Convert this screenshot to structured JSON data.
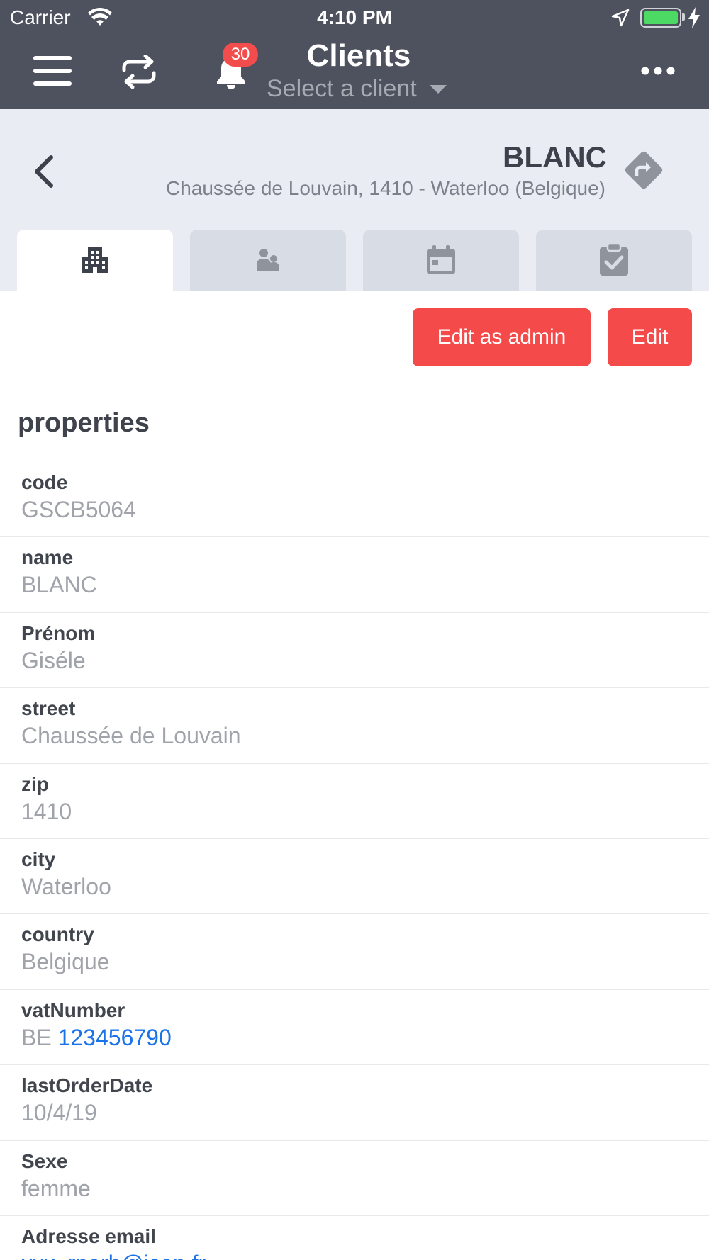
{
  "status_bar": {
    "carrier": "Carrier",
    "time": "4:10 PM"
  },
  "nav": {
    "title": "Clients",
    "subtitle": "Select a client",
    "notification_count": "30",
    "icons": [
      "menu-icon",
      "sync-icon",
      "bell-icon",
      "more-icon"
    ]
  },
  "client": {
    "name": "BLANC",
    "address": "Chaussée de Louvain, 1410 - Waterloo (Belgique)"
  },
  "tabs": [
    {
      "icon": "building-icon",
      "active": true
    },
    {
      "icon": "contacts-icon",
      "active": false
    },
    {
      "icon": "calendar-icon",
      "active": false
    },
    {
      "icon": "clipboard-check-icon",
      "active": false
    }
  ],
  "actions": {
    "edit_admin_label": "Edit as admin",
    "edit_label": "Edit"
  },
  "section_title": "properties",
  "properties": [
    {
      "label": "code",
      "value": "GSCB5064"
    },
    {
      "label": "name",
      "value": "BLANC"
    },
    {
      "label": "Prénom",
      "value": "Giséle"
    },
    {
      "label": "street",
      "value": "Chaussée de Louvain"
    },
    {
      "label": "zip",
      "value": "1410"
    },
    {
      "label": "city",
      "value": "Waterloo"
    },
    {
      "label": "country",
      "value": "Belgique"
    },
    {
      "label": "vatNumber",
      "value_prefix": "BE ",
      "value_link": "123456790"
    },
    {
      "label": "lastOrderDate",
      "value": "10/4/19"
    },
    {
      "label": "Sexe",
      "value": "femme"
    },
    {
      "label": "Adresse email",
      "value_link": "xxx_rparb@json.fr"
    }
  ],
  "colors": {
    "nav_bg": "#4d525e",
    "header_bg": "#e9edf3",
    "accent_red": "#f44a4a",
    "link_blue": "#1a73e8"
  }
}
